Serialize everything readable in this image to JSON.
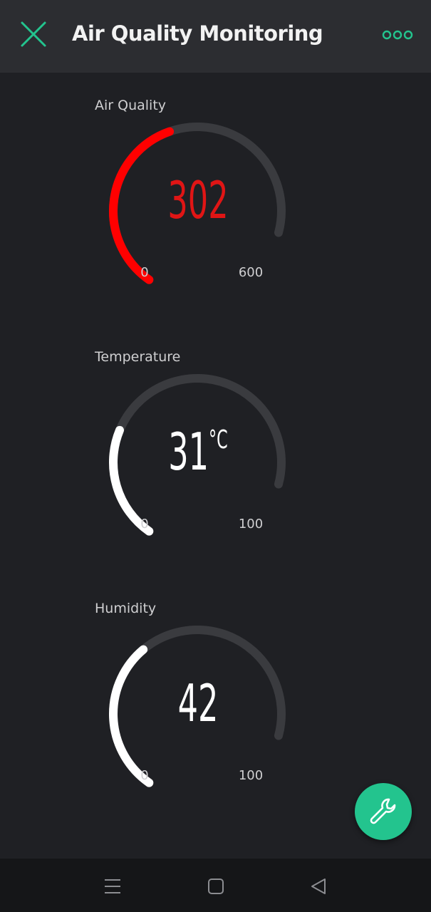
{
  "header": {
    "title": "Air Quality Monitoring",
    "close_icon": "close-icon",
    "more_icon": "more-options-icon"
  },
  "colors": {
    "accent": "#23c48e",
    "track": "#3a3b3f",
    "air_quality": "#ff0000",
    "air_quality_text": "#e01515",
    "white": "#ffffff"
  },
  "widgets": [
    {
      "label": "Air Quality",
      "value": "302",
      "unit": "",
      "min": "0",
      "max": "600",
      "level": 0.503,
      "color": "#ff0000",
      "text_color": "#e01515"
    },
    {
      "label": "Temperature",
      "value": "31",
      "unit": "°C",
      "min": "0",
      "max": "100",
      "level": 0.31,
      "color": "#ffffff",
      "text_color": "#ffffff"
    },
    {
      "label": "Humidity",
      "value": "42",
      "unit": "",
      "min": "0",
      "max": "100",
      "level": 0.42,
      "color": "#ffffff",
      "text_color": "#ffffff"
    }
  ],
  "fab": {
    "icon": "wrench-icon"
  },
  "navigation": {
    "menu_icon": "menu-icon",
    "home_icon": "home-square-icon",
    "back_icon": "back-triangle-icon"
  }
}
